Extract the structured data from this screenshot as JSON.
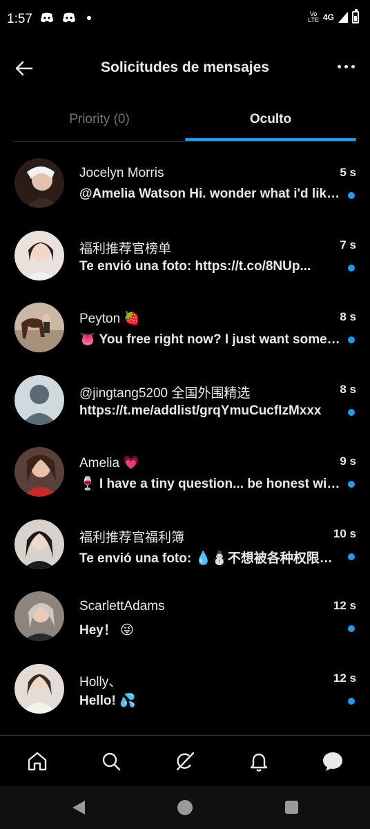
{
  "status_bar": {
    "time": "1:57",
    "volte": "Vo\nLTE",
    "network": "4G"
  },
  "header": {
    "title": "Solicitudes de mensajes"
  },
  "tabs": [
    {
      "label": "Priority (0)",
      "active": false
    },
    {
      "label": "Oculto",
      "active": true
    }
  ],
  "conversations": [
    {
      "name": "Jocelyn Morris",
      "time": "5 s",
      "preview": "@Amelia Watson Hi. wonder what i'd like to know",
      "unread": true,
      "avatar_color": "#6b4a3d"
    },
    {
      "name": "福利推荐官榜单",
      "time": "7 s",
      "preview": "Te envió una foto: https://t.co/8NUp...",
      "unread": true,
      "avatar_color": "#d8c8c2"
    },
    {
      "name": "Peyton 🍓",
      "time": "8 s",
      "preview": "👅 You free right now? I just want some fun",
      "unread": true,
      "avatar_color": "#8b6a4e"
    },
    {
      "name": "@jingtang5200 全国外围精选",
      "time": "8 s",
      "preview": "https://t.me/addlist/grqYmuCucfIzMxxx",
      "unread": true,
      "avatar_color": "#cfd9de"
    },
    {
      "name": "Amelia 💗",
      "time": "9 s",
      "preview": "🍷 I have a tiny question... be honest with me",
      "unread": true,
      "avatar_color": "#b23a3a"
    },
    {
      "name": "福利推荐官福利簿",
      "time": "10 s",
      "preview": "Te envió una foto: 💧⛄不想被各种权限限制",
      "unread": true,
      "avatar_color": "#c9c3bd"
    },
    {
      "name": "ScarlettAdams",
      "time": "12 s",
      "preview": "Hey！ 😜",
      "unread": true,
      "avatar_color": "#9a9088"
    },
    {
      "name": "Holly、",
      "time": "12 s",
      "preview": "Hello! 💦",
      "unread": true,
      "avatar_color": "#d9cfc9"
    }
  ],
  "bottom_nav": [
    {
      "icon": "home-icon"
    },
    {
      "icon": "search-icon"
    },
    {
      "icon": "grok-icon"
    },
    {
      "icon": "bell-icon"
    },
    {
      "icon": "messages-icon"
    }
  ]
}
